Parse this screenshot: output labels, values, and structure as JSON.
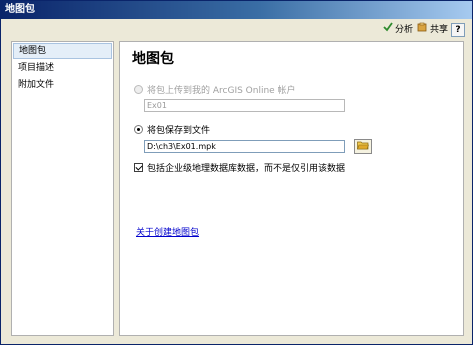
{
  "window": {
    "title": "地图包"
  },
  "toolbar": {
    "analyze_label": "分析",
    "share_label": "共享",
    "help_label": "?"
  },
  "sidebar": {
    "items": [
      {
        "label": "地图包",
        "active": true
      },
      {
        "label": "项目描述",
        "active": false
      },
      {
        "label": "附加文件",
        "active": false
      }
    ]
  },
  "main": {
    "title": "地图包",
    "upload_option": {
      "label": "将包上传到我的 ArcGIS Online 帐户",
      "selected": false,
      "enabled": false,
      "value": "Ex01"
    },
    "save_option": {
      "label": "将包保存到文件",
      "selected": true,
      "path": "D:\\ch3\\Ex01.mpk"
    },
    "include_enterprise": {
      "label": "包括企业级地理数据库数据，而不是仅引用该数据",
      "checked": true
    },
    "about_link": "关于创建地图包"
  },
  "colors": {
    "title_bar_start": "#0a246a",
    "title_bar_end": "#a6caf0",
    "window_bg": "#ece9d8",
    "link": "#0000cc"
  }
}
